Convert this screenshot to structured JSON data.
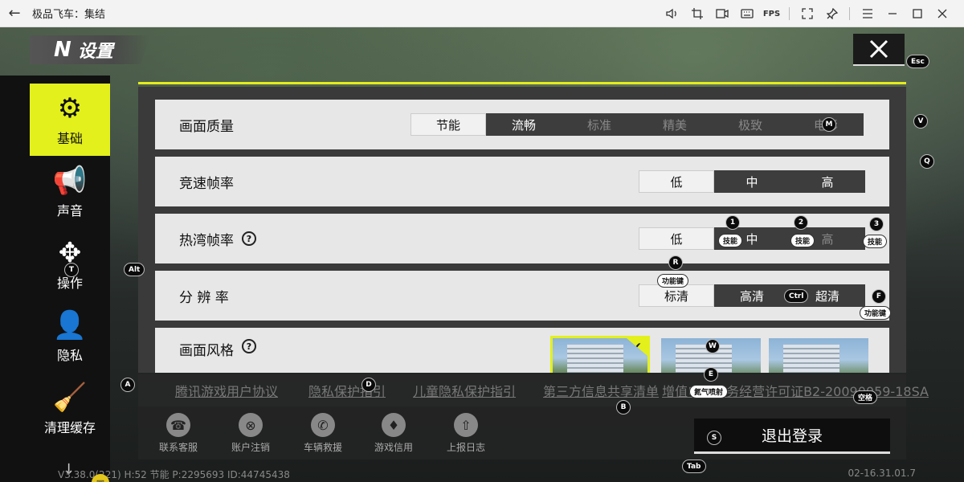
{
  "window": {
    "title": "极品飞车：集结",
    "back_icon": "←",
    "toolbar": {
      "fps_label": "FPS"
    }
  },
  "header": {
    "logo": "N",
    "title": "设置"
  },
  "sidebar": {
    "items": [
      {
        "label": "基础",
        "icon": "⚙"
      },
      {
        "label": "声音",
        "icon": "📢"
      },
      {
        "label": "操作",
        "icon": "✥"
      },
      {
        "label": "隐私",
        "icon": "👤"
      },
      {
        "label": "清理缓存",
        "icon": "🧹"
      }
    ]
  },
  "settings": {
    "quality": {
      "label": "画面质量",
      "options": [
        "节能",
        "流畅",
        "标准",
        "精美",
        "极致",
        "电影"
      ],
      "selected": "节能"
    },
    "race_fps": {
      "label": "竞速帧率",
      "options": [
        "低",
        "中",
        "高"
      ],
      "selected": "低"
    },
    "lobby_fps": {
      "label": "热湾帧率",
      "help": "?",
      "options": [
        "低",
        "中",
        "高"
      ],
      "selected": "低"
    },
    "resolution": {
      "label": "分 辨 率",
      "options": [
        "标清",
        "高清",
        "超清"
      ],
      "selected": "标清"
    },
    "style": {
      "label": "画面风格",
      "help": "?",
      "check": "✔"
    }
  },
  "links": [
    "腾讯游戏用户协议",
    "隐私保护指引",
    "儿童隐私保护指引",
    "第三方信息共享清单",
    "增值电信业务经营许可证B2-20090059-18SA"
  ],
  "tools": [
    {
      "label": "联系客服",
      "icon": "☎"
    },
    {
      "label": "账户注销",
      "icon": "⊗"
    },
    {
      "label": "车辆救援",
      "icon": "✆"
    },
    {
      "label": "游戏信用",
      "icon": "♦"
    },
    {
      "label": "上报日志",
      "icon": "⇧"
    }
  ],
  "logout_label": "退出登录",
  "footer": {
    "version": "V3.38.0(221) H:52 节能 P:2295693 ID:44745438",
    "time": "02-16.31.01.7"
  },
  "keys": {
    "esc": "Esc",
    "v": "V",
    "q": "Q",
    "m": "M",
    "alt": "Alt",
    "t": "T",
    "one": "1",
    "two": "2",
    "three": "3",
    "skill": "技能",
    "r": "R",
    "func": "功能键",
    "ctrl": "Ctrl",
    "f": "F",
    "w": "W",
    "e": "E",
    "nitro": "氮气喷射",
    "a": "A",
    "d": "D",
    "b": "B",
    "space": "空格",
    "s": "S",
    "tab": "Tab"
  },
  "colors": {
    "accent": "#e3f01c",
    "panel": "#e7e7e7",
    "dark": "#111111"
  }
}
